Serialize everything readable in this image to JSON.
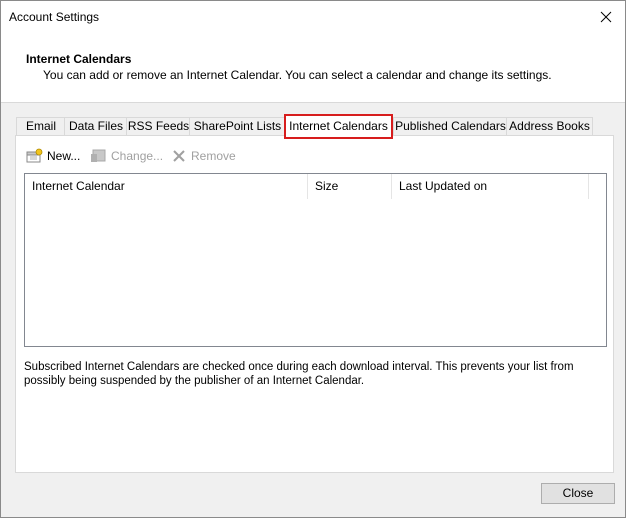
{
  "window": {
    "title": "Account Settings"
  },
  "header": {
    "title": "Internet Calendars",
    "description": "You can add or remove an Internet Calendar. You can select a calendar and change its settings."
  },
  "tabs": [
    {
      "label": "Email"
    },
    {
      "label": "Data Files"
    },
    {
      "label": "RSS Feeds"
    },
    {
      "label": "SharePoint Lists"
    },
    {
      "label": "Internet Calendars",
      "active": true
    },
    {
      "label": "Published Calendars"
    },
    {
      "label": "Address Books"
    }
  ],
  "toolbar": {
    "new_label": "New...",
    "change_label": "Change...",
    "remove_label": "Remove"
  },
  "list": {
    "columns": [
      "Internet Calendar",
      "Size",
      "Last Updated on"
    ]
  },
  "note": "Subscribed Internet Calendars are checked once during each download interval. This prevents your list from possibly being suspended by the publisher of an Internet Calendar.",
  "footer": {
    "close_label": "Close"
  },
  "colors": {
    "highlight": "#d71d1d"
  }
}
